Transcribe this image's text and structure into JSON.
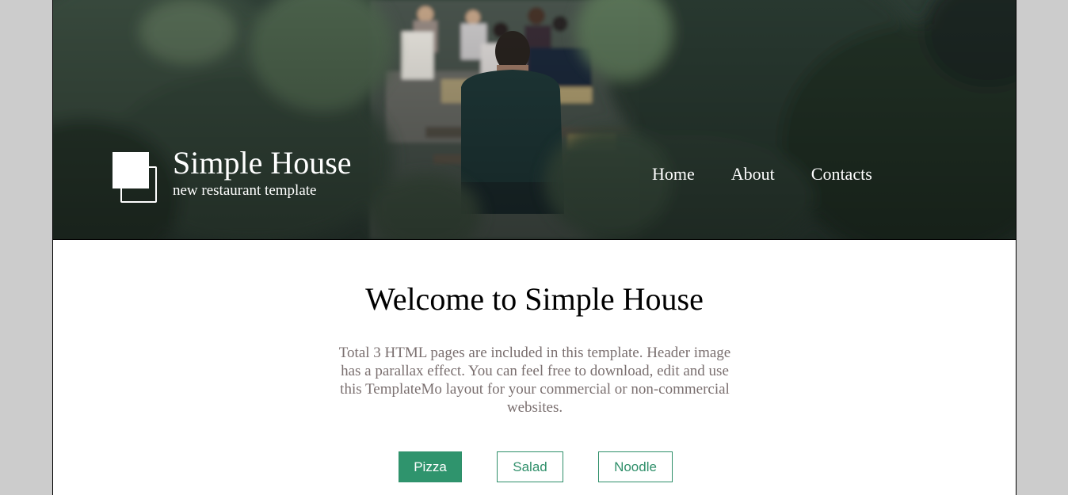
{
  "header": {
    "site_title": "Simple House",
    "tagline": "new restaurant template",
    "nav": [
      {
        "label": "Home"
      },
      {
        "label": "About"
      },
      {
        "label": "Contacts"
      }
    ],
    "hero_image": "restaurant-terrace-photo"
  },
  "main": {
    "heading": "Welcome to Simple House",
    "intro": "Total 3 HTML pages are included in this template. Header image has a parallax effect. You can feel free to download, edit and use this TemplateMo layout for your commercial or non-commercial websites.",
    "menu_tabs": [
      {
        "label": "Pizza",
        "active": true
      },
      {
        "label": "Salad",
        "active": false
      },
      {
        "label": "Noodle",
        "active": false
      }
    ]
  },
  "colors": {
    "accent": "#2f946d",
    "intro_text": "#7a6f6f",
    "page_background": "#cccccc"
  }
}
